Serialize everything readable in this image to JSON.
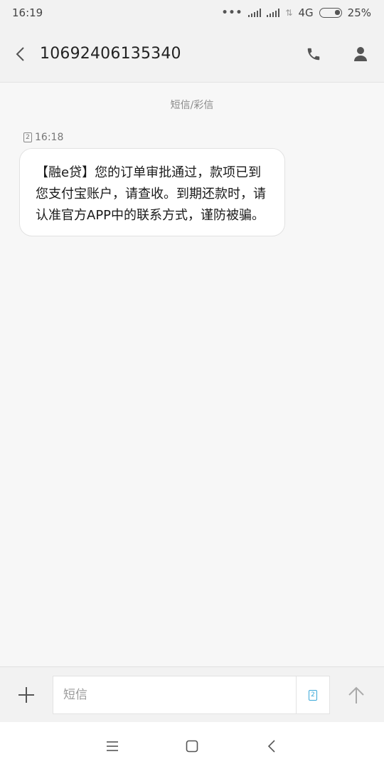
{
  "status_bar": {
    "time": "16:19",
    "network": "4G",
    "battery": "25%",
    "battery_level": 0.25
  },
  "header": {
    "title": "10692406135340",
    "icons": {
      "back": "back-chevron-icon",
      "call": "phone-icon",
      "contact": "person-icon"
    }
  },
  "conversation": {
    "type_label": "短信/彩信",
    "messages": [
      {
        "sim": "2",
        "time": "16:18",
        "lines": [
          "【融e贷】您的订单审批通过，款项已到",
          "您支付宝账户，请查收。到期还款时，请",
          "认准官方APP中的联系方式，谨防被骗。"
        ]
      }
    ]
  },
  "composer": {
    "placeholder": "短信",
    "sim": "2",
    "accent_color": "#3aa8d8",
    "icons": {
      "add": "plus-icon",
      "send": "send-arrow-icon"
    }
  },
  "nav_bar": {
    "icons": {
      "menu": "menu-icon",
      "home": "home-square-icon",
      "back": "back-icon"
    }
  }
}
